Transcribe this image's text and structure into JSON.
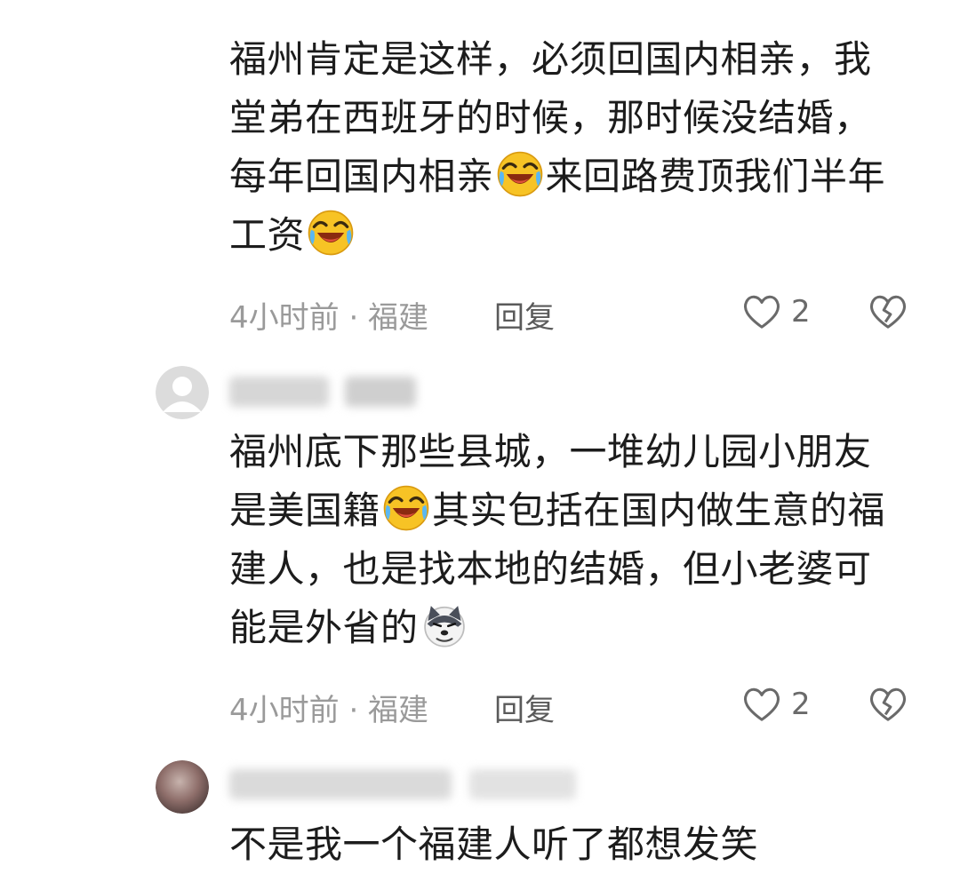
{
  "comments": [
    {
      "text_lines": [
        "福州肯定是这样，必须回国内相亲，我",
        "堂弟在西班牙的时候，那时候没结婚，"
      ],
      "line3_a": "每年回国内相亲",
      "line3_b": "来回路费顶我们半年",
      "line4": "工资",
      "time_location": "4小时前 · 福建",
      "reply_label": "回复",
      "likes": "2"
    },
    {
      "line1": "福州底下那些县城，一堆幼儿园小朋友",
      "line2_a": "是美国籍",
      "line2_b": "其实包括在国内做生意的福",
      "line3": "建人，也是找本地的结婚，但小老婆可",
      "line4": "能是外省的",
      "time_location": "4小时前 · 福建",
      "reply_label": "回复",
      "likes": "2"
    },
    {
      "line1": "不是我一个福建人听了都想发笑"
    }
  ],
  "icons": {
    "laugh_cry": "laughing-crying-emoji-icon",
    "doge": "doge-emoji-icon",
    "like": "heart-outline-icon",
    "dislike": "broken-heart-icon",
    "default_avatar": "default-avatar-icon"
  },
  "colors": {
    "text": "#1c1c1c",
    "meta": "#9a9a9a",
    "reply": "#5a5a5a",
    "icon": "#6a6a6a"
  }
}
